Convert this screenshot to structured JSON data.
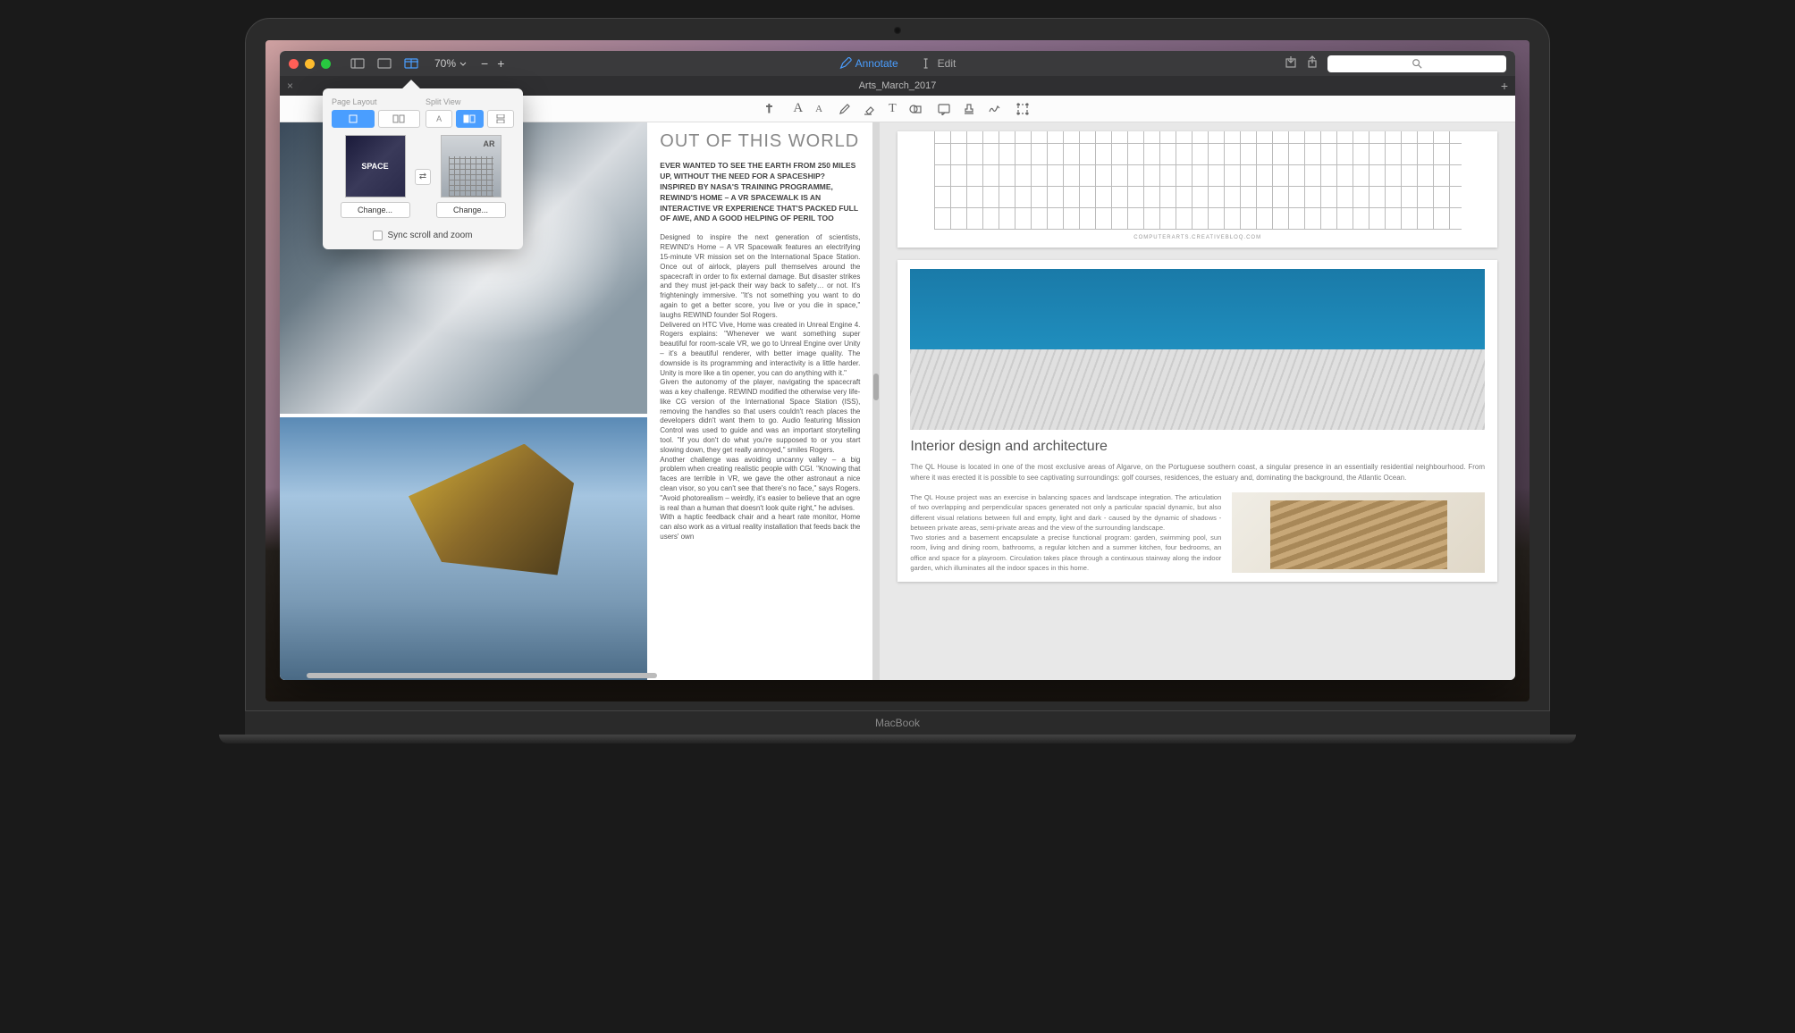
{
  "titlebar": {
    "zoom": "70%",
    "annotate": "Annotate",
    "edit": "Edit"
  },
  "tab": {
    "name": "Arts_March_2017"
  },
  "popover": {
    "page_layout_label": "Page Layout",
    "split_view_label": "Split View",
    "thumb1_text": "SPACE",
    "thumb2_text": "AR",
    "change_label": "Change...",
    "sync_label": "Sync scroll and zoom"
  },
  "left_page": {
    "headline": "OUT OF THIS WORLD",
    "lede": "EVER WANTED TO SEE THE EARTH FROM 250 MILES UP, WITHOUT THE NEED FOR A SPACESHIP? INSPIRED BY NASA'S TRAINING PROGRAMME, REWIND'S HOME – A VR SPACEWALK IS AN INTERACTIVE VR EXPERIENCE THAT'S PACKED FULL OF AWE, AND A GOOD HELPING OF PERIL TOO",
    "body": "Designed to inspire the next generation of scientists, REWIND's Home – A VR Spacewalk features an electrifying 15-minute VR mission set on the International Space Station. Once out of airlock, players pull themselves around the spacecraft in order to fix external damage. But disaster strikes and they must jet-pack their way back to safety… or not. It's frighteningly immersive. \"It's not something you want to do again to get a better score, you live or you die in space,\" laughs REWIND founder Sol Rogers.\n    Delivered on HTC Vive, Home was created in Unreal Engine 4. Rogers explains: \"Whenever we want something super beautiful for room-scale VR, we go to Unreal Engine over Unity – it's a beautiful renderer, with better image quality. The downside is its programming and interactivity is a little harder. Unity is more like a tin opener, you can do anything with it.\"\n    Given the autonomy of the player, navigating the spacecraft was a key challenge. REWIND modified the otherwise very life-like CG version of the International Space Station (ISS), removing the handles so that users couldn't reach places the developers didn't want them to go. Audio featuring Mission Control was used to guide and was an important storytelling tool. \"If you don't do what you're supposed to or you start slowing down, they get really annoyed,\" smiles Rogers.\n    Another challenge was avoiding uncanny valley – a big problem when creating realistic people with CGI. \"Knowing that faces are terrible in VR, we gave the other astronaut a nice clean visor, so you can't see that there's no face,\" says Rogers. \"Avoid photorealism – weirdly, it's easier to believe that an ogre is real than a human that doesn't look quite right,\" he advises.\n    With a haptic feedback chair and a heart rate monitor, Home can also work as a virtual reality installation that feeds back the users' own"
  },
  "right_top": {
    "caption": "COMPUTERARTS.CREATIVEBLOQ.COM"
  },
  "right_bottom": {
    "heading": "Interior design and architecture",
    "intro": "The QL House is located in one of the most exclusive areas of Algarve, on the Portuguese southern coast, a singular presence in an essentially residential neighbourhood. From where it was erected it is possible to see captivating surroundings: golf courses, residences, the estuary and, dominating the background, the Atlantic Ocean.",
    "col1": "The QL House project was an exercise in balancing spaces and landscape integration. The articulation of two overlapping and perpendicular spaces generated not only a particular spacial dynamic, but also different visual relations between full and empty, light and dark - caused by the dynamic of shadows - between private areas, semi-private areas and the view of the surrounding landscape.\n    Two stories and a basement encapsulate a precise functional program: garden, swimming pool, sun room, living and dining room, bathrooms, a regular kitchen and a summer kitchen, four bedrooms, an office and space for a playroom. Circulation takes place through a continuous stairway along the indoor garden, which illuminates all the indoor spaces in this home."
  },
  "macbook_label": "MacBook"
}
